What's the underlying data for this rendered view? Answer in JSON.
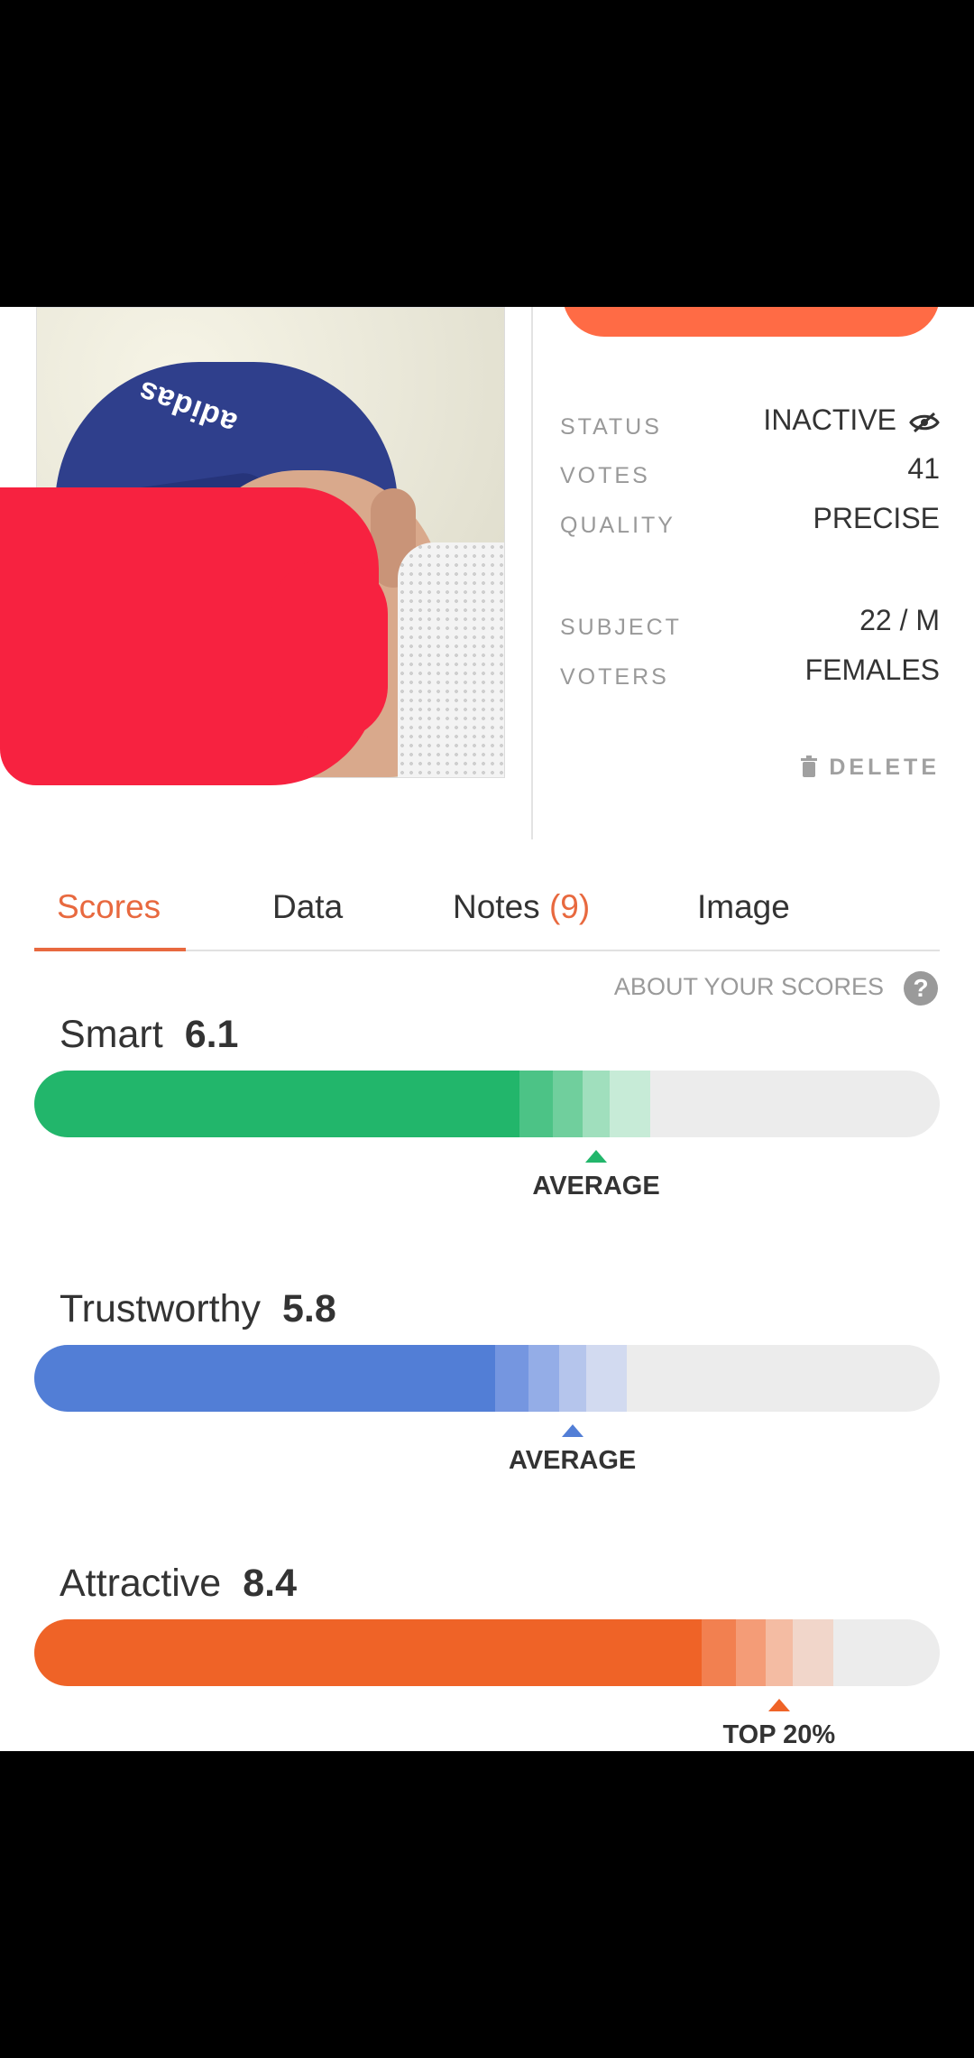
{
  "accent": "#e8693f",
  "info": {
    "status_label": "STATUS",
    "status_value": "INACTIVE",
    "votes_label": "VOTES",
    "votes_value": "41",
    "quality_label": "QUALITY",
    "quality_value": "PRECISE",
    "subject_label": "SUBJECT",
    "subject_value": "22 / M",
    "voters_label": "VOTERS",
    "voters_value": "FEMALES",
    "delete_label": "DELETE"
  },
  "photo": {
    "logo_text": "adidas"
  },
  "tabs": [
    {
      "label": "Scores",
      "active": true
    },
    {
      "label": "Data"
    },
    {
      "label": "Notes ",
      "badge": "(9)"
    },
    {
      "label": "Image"
    }
  ],
  "about_label": "ABOUT YOUR SCORES",
  "scores": [
    {
      "label": "Smart",
      "value": "6.1",
      "score": 6.1,
      "marker_label": "AVERAGE",
      "colors": [
        "#22b66b",
        "#4cc386",
        "#70cf9d",
        "#a0dfbd",
        "#c7ebd7"
      ]
    },
    {
      "label": "Trustworthy",
      "value": "5.8",
      "score": 5.8,
      "marker_label": "AVERAGE",
      "colors": [
        "#527ed6",
        "#7596e0",
        "#94ade7",
        "#b5c5ec",
        "#d2daf0"
      ]
    },
    {
      "label": "Attractive",
      "value": "8.4",
      "score": 8.4,
      "marker_label": "TOP 20%",
      "colors": [
        "#ef6327",
        "#f28050",
        "#f49c77",
        "#f4bca3",
        "#f1d6ca"
      ]
    }
  ]
}
